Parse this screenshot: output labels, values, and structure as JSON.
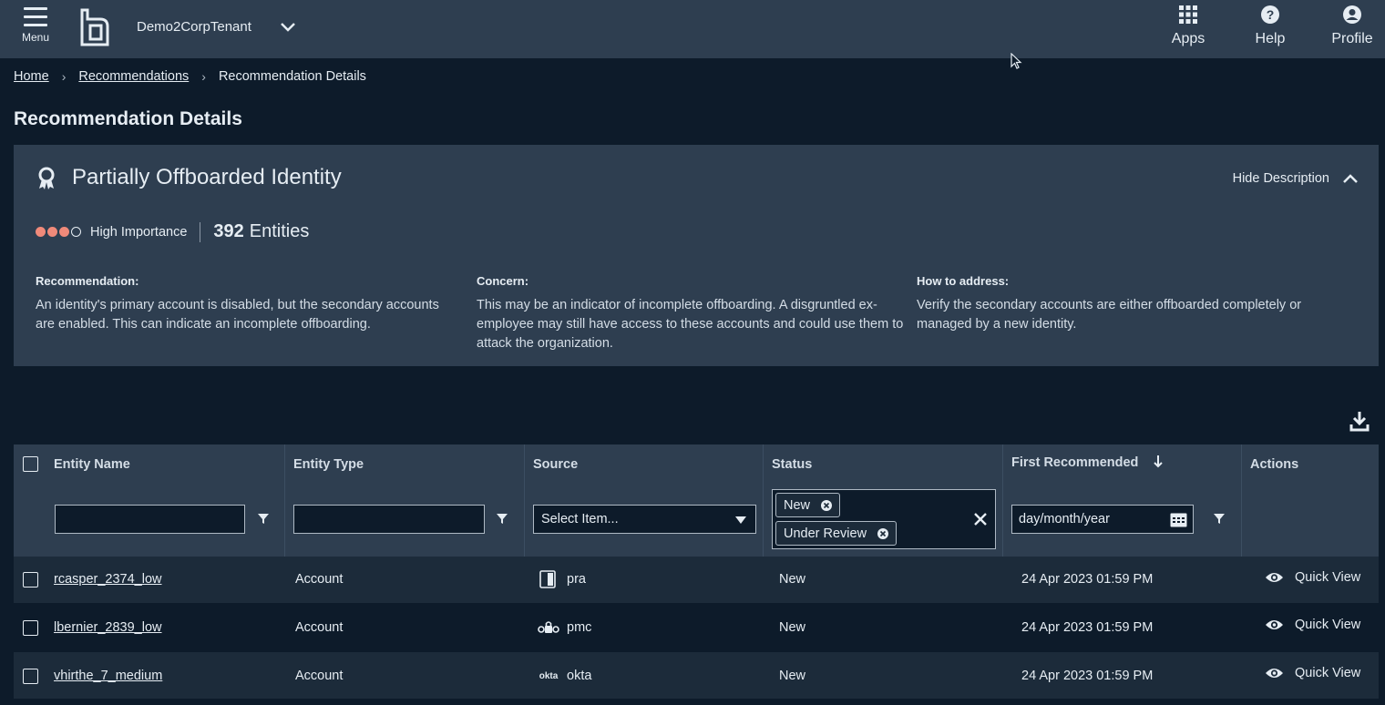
{
  "header": {
    "menu_label": "Menu",
    "tenant": "Demo2CorpTenant",
    "apps_label": "Apps",
    "help_label": "Help",
    "profile_label": "Profile"
  },
  "breadcrumb": {
    "home": "Home",
    "recommendations": "Recommendations",
    "current": "Recommendation Details"
  },
  "page_title": "Recommendation Details",
  "recommendation": {
    "title": "Partially Offboarded Identity",
    "hide_description": "Hide Description",
    "importance_level": 3,
    "importance_max": 4,
    "importance_color": "#f08a7a",
    "importance_label": "High Importance",
    "entities_count": "392",
    "entities_label": "Entities",
    "recommendation_heading": "Recommendation:",
    "recommendation_text": "An identity's primary account is disabled, but the secondary accounts are enabled. This can indicate an incomplete offboarding.",
    "concern_heading": "Concern:",
    "concern_text": "This may be an indicator of incomplete offboarding. A disgruntled ex-employee may still have access to these accounts and could use them to attack the organization.",
    "address_heading": "How to address:",
    "address_text": "Verify the secondary accounts are either offboarded completely or managed by a new identity."
  },
  "table": {
    "columns": {
      "entity_name": "Entity Name",
      "entity_type": "Entity Type",
      "source": "Source",
      "status": "Status",
      "first_recommended": "First Recommended",
      "actions": "Actions"
    },
    "filters": {
      "entity_name_value": "",
      "entity_type_value": "",
      "source_placeholder": "Select Item...",
      "status_chips": [
        "New",
        "Under Review"
      ],
      "date_placeholder": "day/month/year"
    },
    "rows": [
      {
        "name": "rcasper_2374_low",
        "type": "Account",
        "source_icon": "pra-icon",
        "source": "pra",
        "status": "New",
        "first_recommended": "24 Apr 2023 01:59 PM",
        "action": "Quick View"
      },
      {
        "name": "lbernier_2839_low",
        "type": "Account",
        "source_icon": "pmc-icon",
        "source": "pmc",
        "status": "New",
        "first_recommended": "24 Apr 2023 01:59 PM",
        "action": "Quick View"
      },
      {
        "name": "vhirthe_7_medium",
        "type": "Account",
        "source_icon": "okta-logo",
        "source_icon_text": "okta",
        "source": "okta",
        "status": "New",
        "first_recommended": "24 Apr 2023 01:59 PM",
        "action": "Quick View"
      }
    ]
  }
}
